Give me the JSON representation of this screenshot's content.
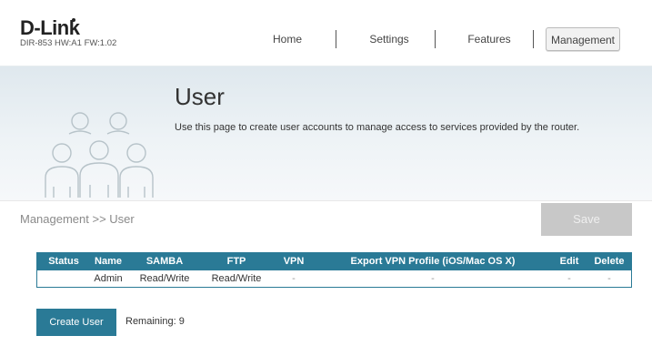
{
  "brand": {
    "logo": "D-Link",
    "model": "DIR-853 HW:A1 FW:1.02"
  },
  "nav": {
    "items": [
      {
        "label": "Home",
        "active": false
      },
      {
        "label": "Settings",
        "active": false
      },
      {
        "label": "Features",
        "active": false
      },
      {
        "label": "Management",
        "active": true
      }
    ]
  },
  "banner": {
    "title": "User",
    "description": "Use this page to create user accounts to manage access to services provided by the router.",
    "icon": "users-group-icon"
  },
  "breadcrumb": "Management >> User",
  "save_label": "Save",
  "table": {
    "headers": [
      "Status",
      "Name",
      "SAMBA",
      "FTP",
      "VPN",
      "Export VPN Profile (iOS/Mac OS X)",
      "Edit",
      "Delete"
    ],
    "rows": [
      [
        "",
        "Admin",
        "Read/Write",
        "Read/Write",
        "-",
        "-",
        "-",
        "-"
      ]
    ]
  },
  "create_label": "Create User",
  "remaining_text": "Remaining: 9",
  "colors": {
    "accent": "#2a7a96",
    "save_disabled": "#c8c8c8"
  }
}
